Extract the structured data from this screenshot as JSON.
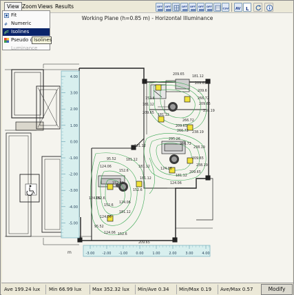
{
  "menubar": {
    "view": "View",
    "zoom": "Zoom",
    "views": "Views",
    "results": "Results"
  },
  "view_menu": {
    "fit": "Fit",
    "numeric": "Numeric",
    "isolines": "Isolines",
    "pseudo_colors": "Pseudo co",
    "luminance": "Luminance"
  },
  "tooltip": "Isolines",
  "toolbar": {
    "buttons": [
      "OFF",
      "OFF",
      "OFF",
      "OFF",
      "OFF",
      "OFF",
      "CSV",
      "AV",
      "L",
      "refresh",
      "info"
    ]
  },
  "plane_title": "Working Plane (h=0.85 m) - Horizontal Illuminance",
  "scale": {
    "unit": "m",
    "vertical_ticks": [
      "4.00",
      "3.00",
      "2.00",
      "1.00",
      "0.00",
      "-1.00",
      "-2.00",
      "-3.00",
      "-4.00",
      "-5.00"
    ],
    "horizontal_ticks": [
      "-3.00",
      "-2.00",
      "-1.00",
      "0.00",
      "1.00",
      "2.00",
      "3.00",
      "4.00"
    ]
  },
  "isoline_labels": [
    "209.65",
    "181.12",
    "209.65",
    "209.6",
    "266.72",
    "152.6",
    "181.12",
    "209.65",
    "238.19",
    "181.12",
    "209.65",
    "266.72",
    "209.65",
    "238.19",
    "266.72",
    "295.26",
    "266.72",
    "238.19",
    "181.12",
    "209.65",
    "238.19",
    "181.12",
    "124.06",
    "209.65",
    "181.12",
    "124.06",
    "95.52",
    "152.6",
    "124.06",
    "181.12",
    "152.89",
    "181.12",
    "152.6",
    "124.06",
    "124.06",
    "152.6",
    "124.06",
    "181.12",
    "95.52",
    "124.06",
    "152.6",
    "209.65",
    "152.6"
  ],
  "status": {
    "ave": "Ave  199.24  lux",
    "min": "Min  66.99  lux",
    "max": "Max  352.32  lux",
    "min_ave": "Min/Ave  0.34",
    "min_max": "Min/Max  0.19",
    "ave_max": "Ave/Max  0.57",
    "modify": "Modify"
  },
  "colors": {
    "isoline": "#3aa852",
    "wall": "#222222",
    "ruler_fill": "#d8efee",
    "ruler_stroke": "#7fb7c4",
    "luminaire": "#f0e23a",
    "menu_highlight": "#0a246a"
  }
}
